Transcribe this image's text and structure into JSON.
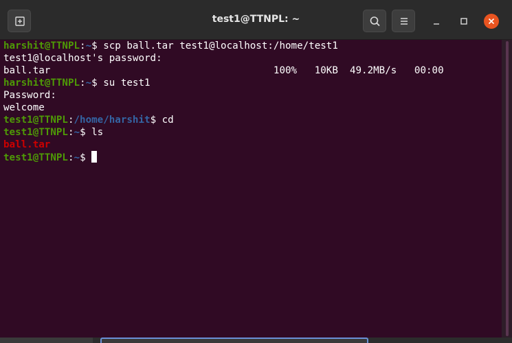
{
  "window": {
    "title": "test1@TTNPL: ~"
  },
  "icons": {
    "new_tab": "new-tab-icon",
    "search": "search-icon",
    "menu": "hamburger-menu-icon",
    "minimize": "minimize-icon",
    "maximize": "maximize-icon",
    "close": "close-icon"
  },
  "colors": {
    "terminal_bg": "#300a24",
    "prompt_user": "#4e9a06",
    "prompt_path": "#3465a4",
    "archive_file": "#cc0000",
    "close_button": "#e95420"
  },
  "terminal": {
    "lines": [
      {
        "user": "harshit@TTNPL",
        "sep": ":",
        "path": "~",
        "rest": "$ scp ball.tar test1@localhost:/home/test1"
      },
      {
        "text": "test1@localhost's password: "
      },
      {
        "text": "ball.tar                                      100%   10KB  49.2MB/s   00:00"
      },
      {
        "user": "harshit@TTNPL",
        "sep": ":",
        "path": "~",
        "rest": "$ su test1"
      },
      {
        "text": "Password: "
      },
      {
        "text": "welcome"
      },
      {
        "user": "test1@TTNPL",
        "sep": ":",
        "path": "/home/harshit",
        "rest": "$ cd"
      },
      {
        "user": "test1@TTNPL",
        "sep": ":",
        "path": "~",
        "rest": "$ ls"
      },
      {
        "red": "ball.tar"
      },
      {
        "user": "test1@TTNPL",
        "sep": ":",
        "path": "~",
        "rest": "$ "
      }
    ]
  }
}
